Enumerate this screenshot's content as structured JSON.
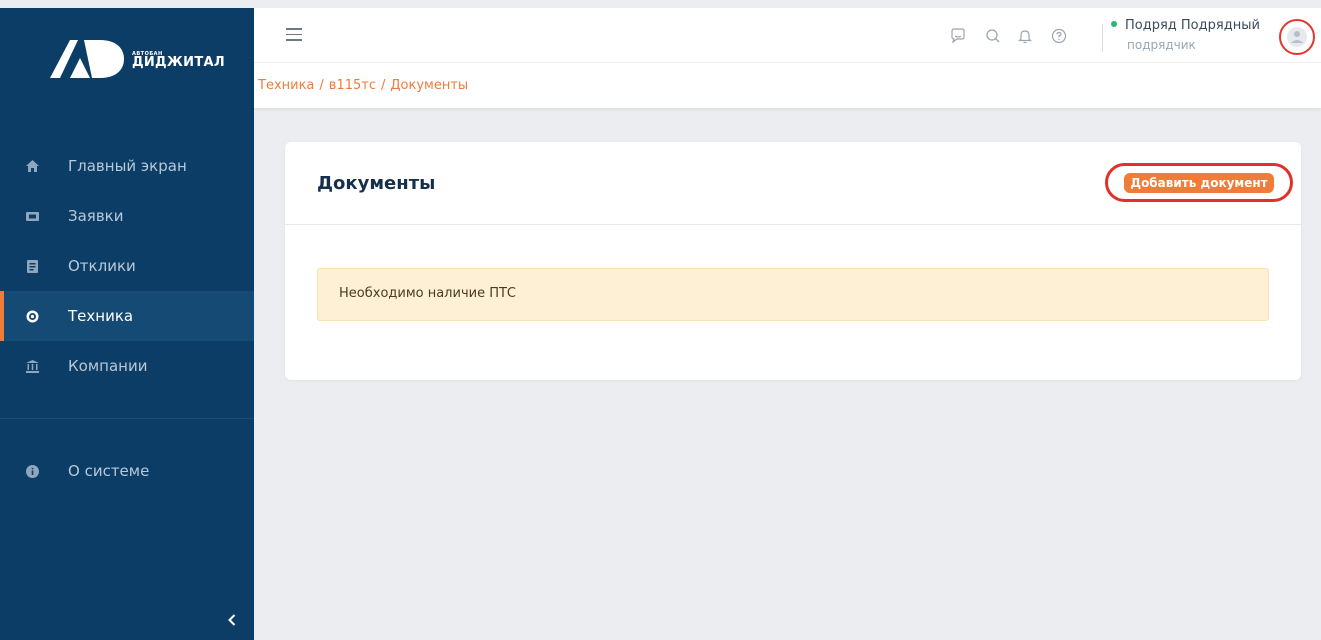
{
  "brand": {
    "small": "АВТОБАН",
    "name": "ДИДЖИТАЛ"
  },
  "sidebar": {
    "items": [
      {
        "label": "Главный экран",
        "icon": "home-icon"
      },
      {
        "label": "Заявки",
        "icon": "ticket-icon"
      },
      {
        "label": "Отклики",
        "icon": "document-icon"
      },
      {
        "label": "Техника",
        "icon": "wheel-icon",
        "active": true
      },
      {
        "label": "Компании",
        "icon": "bank-icon"
      }
    ],
    "about": {
      "label": "О системе",
      "icon": "info-icon"
    },
    "collapse_icon": "chevron-left-icon"
  },
  "header": {
    "icons": [
      "chat-icon",
      "search-icon",
      "bell-icon",
      "help-icon"
    ],
    "user": {
      "name": "Подряд Подрядный",
      "role": "подрядчик",
      "status_color": "#2bb673"
    }
  },
  "breadcrumb": {
    "items": [
      "Техника",
      "в115тс",
      "Документы"
    ],
    "separator": "/"
  },
  "main": {
    "title": "Документы",
    "add_button": "Добавить документ",
    "alert": "Необходимо наличие ПТС"
  },
  "colors": {
    "sidebar_bg": "#0b3d66",
    "accent": "#f07c3a",
    "highlight_outline": "#e2312b",
    "alert_bg": "#fdf0d5"
  }
}
